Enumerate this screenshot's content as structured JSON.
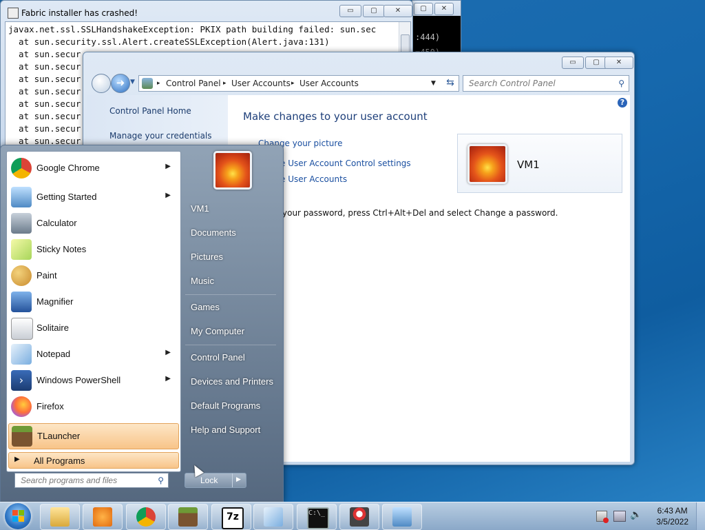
{
  "crash_window": {
    "title": "Fabric installer has crashed!",
    "lines": [
      "javax.net.ssl.SSLHandshakeException: PKIX path building failed: sun.sec",
      "  at sun.security.ssl.Alert.createSSLException(Alert.java:131)",
      "  at sun.secur",
      "  at sun.secur",
      "  at sun.secur",
      "  at sun.secur",
      "  at sun.secur",
      "  at sun.secur",
      "  at sun.secur",
      "  at sun.secur"
    ],
    "controls": {
      "min": "▭",
      "max": "▢",
      "close": "✕"
    }
  },
  "console": {
    "line1": ":444)",
    "line2": "=450)"
  },
  "control_panel": {
    "breadcrumb": [
      "Control Panel",
      "User Accounts",
      "User Accounts"
    ],
    "search_placeholder": "Search Control Panel",
    "left_links": [
      "Control Panel Home",
      "Manage your credentials"
    ],
    "heading": "Make changes to your user account",
    "actions": [
      "Change your picture",
      "e User Account Control settings",
      "e User Accounts"
    ],
    "password_note": "your password, press Ctrl+Alt+Del and select Change a password.",
    "user_name": "VM1",
    "controls": {
      "min": "▭",
      "max": "▢",
      "close": "✕"
    }
  },
  "start_menu": {
    "programs": [
      {
        "label": "Google Chrome",
        "submenu": true,
        "icon": "chrome-icon",
        "color": "#db4437"
      },
      {
        "label": "Getting Started",
        "submenu": true,
        "icon": "getting-started-icon",
        "color": "#6aa6d8"
      },
      {
        "label": "Calculator",
        "submenu": false,
        "icon": "calculator-icon",
        "color": "#7d8d9d"
      },
      {
        "label": "Sticky Notes",
        "submenu": false,
        "icon": "sticky-notes-icon",
        "color": "#d9e86a"
      },
      {
        "label": "Paint",
        "submenu": false,
        "icon": "paint-icon",
        "color": "#e8b354"
      },
      {
        "label": "Magnifier",
        "submenu": false,
        "icon": "magnifier-icon",
        "color": "#4f7fc4"
      },
      {
        "label": "Solitaire",
        "submenu": false,
        "icon": "solitaire-icon",
        "color": "#d8dde3"
      },
      {
        "label": "Notepad",
        "submenu": true,
        "icon": "notepad-icon",
        "color": "#8fb7e0"
      },
      {
        "label": "Windows PowerShell",
        "submenu": true,
        "icon": "powershell-icon",
        "color": "#2d4f8a"
      },
      {
        "label": "Firefox",
        "submenu": false,
        "icon": "firefox-icon",
        "color": "#ff7139"
      },
      {
        "label": "TLauncher",
        "submenu": false,
        "icon": "tlauncher-icon",
        "color": "#5b7a2d"
      }
    ],
    "all_programs": "All Programs",
    "search_placeholder": "Search programs and files",
    "right_items": [
      "VM1",
      "Documents",
      "Pictures",
      "Music",
      "Games",
      "My Computer",
      "Control Panel",
      "Devices and Printers",
      "Default Programs",
      "Help and Support"
    ],
    "lock_label": "Lock"
  },
  "taskbar": {
    "time": "6:43 AM",
    "date": "3/5/2022",
    "items": [
      "explorer-icon",
      "media-player-icon",
      "chrome-icon",
      "minecraft-icon",
      "7zip-icon",
      "notepad-icon",
      "cmd-icon",
      "java-icon",
      "control-panel-icon"
    ]
  }
}
